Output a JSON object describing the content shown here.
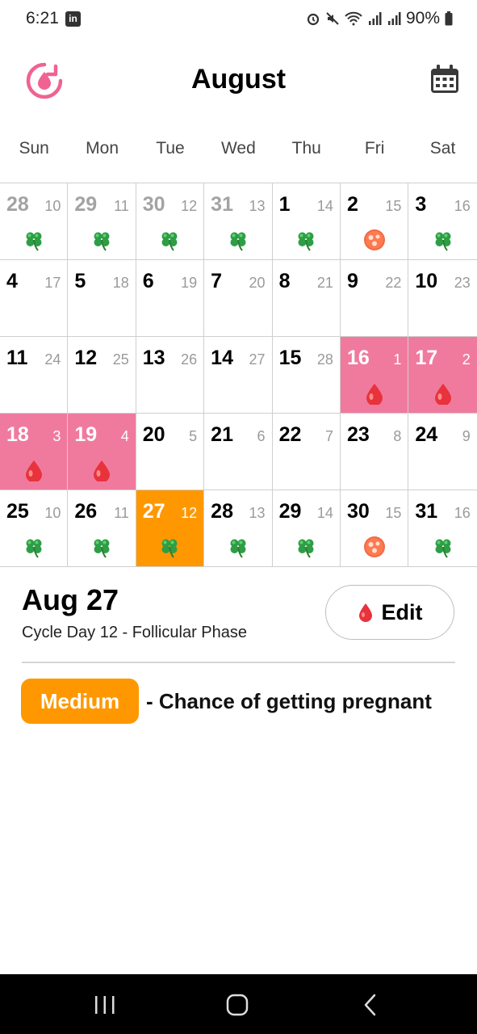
{
  "status_bar": {
    "time": "6:21",
    "battery": "90%"
  },
  "header": {
    "month": "August"
  },
  "weekdays": [
    "Sun",
    "Mon",
    "Tue",
    "Wed",
    "Thu",
    "Fri",
    "Sat"
  ],
  "colors": {
    "period": "#f07a9e",
    "today": "#ff9800",
    "accent": "#f06292"
  },
  "calendar": {
    "weeks": [
      [
        {
          "day": "28",
          "cycle": "10",
          "icon": "clover-icon",
          "prev": true
        },
        {
          "day": "29",
          "cycle": "11",
          "icon": "clover-icon",
          "prev": true
        },
        {
          "day": "30",
          "cycle": "12",
          "icon": "clover-icon",
          "prev": true
        },
        {
          "day": "31",
          "cycle": "13",
          "icon": "clover-icon",
          "prev": true
        },
        {
          "day": "1",
          "cycle": "14",
          "icon": "clover-icon"
        },
        {
          "day": "2",
          "cycle": "15",
          "icon": "ovulation-egg-icon"
        },
        {
          "day": "3",
          "cycle": "16",
          "icon": "clover-icon"
        }
      ],
      [
        {
          "day": "4",
          "cycle": "17"
        },
        {
          "day": "5",
          "cycle": "18"
        },
        {
          "day": "6",
          "cycle": "19"
        },
        {
          "day": "7",
          "cycle": "20"
        },
        {
          "day": "8",
          "cycle": "21"
        },
        {
          "day": "9",
          "cycle": "22"
        },
        {
          "day": "10",
          "cycle": "23"
        }
      ],
      [
        {
          "day": "11",
          "cycle": "24"
        },
        {
          "day": "12",
          "cycle": "25"
        },
        {
          "day": "13",
          "cycle": "26"
        },
        {
          "day": "14",
          "cycle": "27"
        },
        {
          "day": "15",
          "cycle": "28"
        },
        {
          "day": "16",
          "cycle": "1",
          "icon": "blood-drop-icon",
          "period": true
        },
        {
          "day": "17",
          "cycle": "2",
          "icon": "blood-drop-icon",
          "period": true
        }
      ],
      [
        {
          "day": "18",
          "cycle": "3",
          "icon": "blood-drop-icon",
          "period": true
        },
        {
          "day": "19",
          "cycle": "4",
          "icon": "blood-drop-icon",
          "period": true
        },
        {
          "day": "20",
          "cycle": "5"
        },
        {
          "day": "21",
          "cycle": "6"
        },
        {
          "day": "22",
          "cycle": "7"
        },
        {
          "day": "23",
          "cycle": "8"
        },
        {
          "day": "24",
          "cycle": "9"
        }
      ],
      [
        {
          "day": "25",
          "cycle": "10",
          "icon": "clover-icon"
        },
        {
          "day": "26",
          "cycle": "11",
          "icon": "clover-icon"
        },
        {
          "day": "27",
          "cycle": "12",
          "icon": "clover-icon",
          "today": true
        },
        {
          "day": "28",
          "cycle": "13",
          "icon": "clover-icon"
        },
        {
          "day": "29",
          "cycle": "14",
          "icon": "clover-icon"
        },
        {
          "day": "30",
          "cycle": "15",
          "icon": "ovulation-egg-icon"
        },
        {
          "day": "31",
          "cycle": "16",
          "icon": "clover-icon"
        }
      ]
    ]
  },
  "detail": {
    "date": "Aug 27",
    "phase": "Cycle Day 12 - Follicular Phase",
    "edit_label": "Edit",
    "chance_level": "Medium",
    "chance_text": "- Chance of getting pregnant"
  }
}
